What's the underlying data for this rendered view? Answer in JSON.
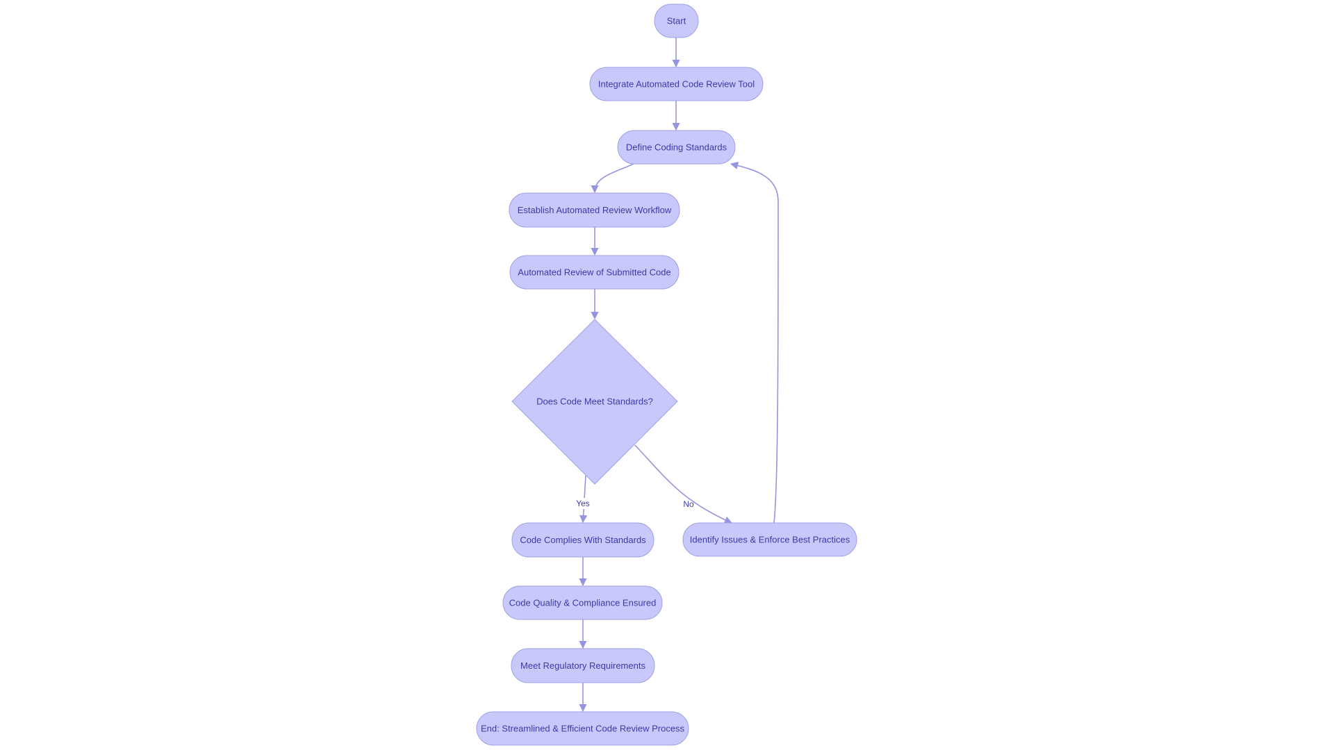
{
  "diagram": {
    "type": "flowchart",
    "colors": {
      "node_fill": "#c8c8fa",
      "node_stroke": "#9f9fe8",
      "text": "#3a3aa8",
      "edge": "#9494e0"
    },
    "nodes": [
      {
        "id": "start",
        "label": "Start",
        "shape": "stadium"
      },
      {
        "id": "integrate",
        "label": "Integrate Automated Code Review Tool",
        "shape": "stadium"
      },
      {
        "id": "define",
        "label": "Define Coding Standards",
        "shape": "stadium"
      },
      {
        "id": "establish",
        "label": "Establish Automated Review Workflow",
        "shape": "stadium"
      },
      {
        "id": "review",
        "label": "Automated Review of Submitted Code",
        "shape": "stadium"
      },
      {
        "id": "decision",
        "label": "Does Code Meet Standards?",
        "shape": "diamond"
      },
      {
        "id": "complies",
        "label": "Code Complies With Standards",
        "shape": "stadium"
      },
      {
        "id": "identify",
        "label": "Identify Issues & Enforce Best Practices",
        "shape": "stadium"
      },
      {
        "id": "quality",
        "label": "Code Quality & Compliance Ensured",
        "shape": "stadium"
      },
      {
        "id": "regulatory",
        "label": "Meet Regulatory Requirements",
        "shape": "stadium"
      },
      {
        "id": "end",
        "label": "End: Streamlined & Efficient Code Review Process",
        "shape": "stadium"
      }
    ],
    "edges": [
      {
        "from": "start",
        "to": "integrate",
        "label": ""
      },
      {
        "from": "integrate",
        "to": "define",
        "label": ""
      },
      {
        "from": "define",
        "to": "establish",
        "label": ""
      },
      {
        "from": "establish",
        "to": "review",
        "label": ""
      },
      {
        "from": "review",
        "to": "decision",
        "label": ""
      },
      {
        "from": "decision",
        "to": "complies",
        "label": "Yes"
      },
      {
        "from": "decision",
        "to": "identify",
        "label": "No"
      },
      {
        "from": "identify",
        "to": "define",
        "label": ""
      },
      {
        "from": "complies",
        "to": "quality",
        "label": ""
      },
      {
        "from": "quality",
        "to": "regulatory",
        "label": ""
      },
      {
        "from": "regulatory",
        "to": "end",
        "label": ""
      }
    ]
  }
}
